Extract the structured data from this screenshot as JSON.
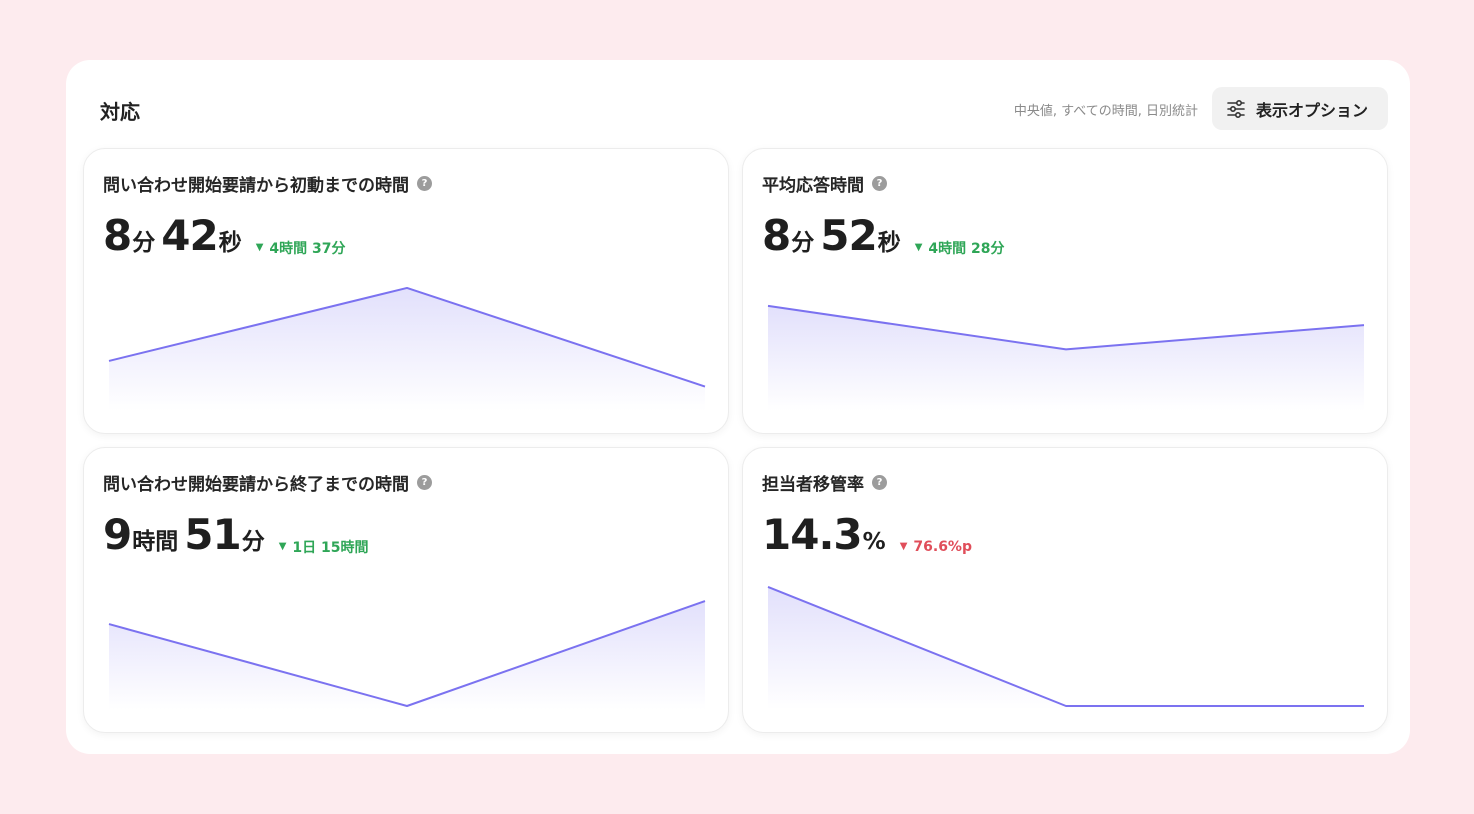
{
  "header": {
    "title": "対応",
    "subtitle": "中央値, すべての時間, 日別統計",
    "options_label": "表示オプション"
  },
  "colors": {
    "background": "#fdebee",
    "line": "#7b72f0",
    "positive": "#2fa657",
    "negative": "#e04e5a"
  },
  "cards": [
    {
      "title": "問い合わせ開始要請から初動までの時間",
      "value": [
        {
          "num": "8",
          "unit": "分"
        },
        {
          "num": "42",
          "unit": "秒"
        }
      ],
      "delta": {
        "text": "4時間 37分",
        "tone": "good",
        "icon": "triangle-down-icon"
      },
      "trend": [
        0.36,
        0.93,
        0.16
      ]
    },
    {
      "title": "平均応答時間",
      "value": [
        {
          "num": "8",
          "unit": "分"
        },
        {
          "num": "52",
          "unit": "秒"
        }
      ],
      "delta": {
        "text": "4時間 28分",
        "tone": "good",
        "icon": "triangle-down-icon"
      },
      "trend": [
        0.79,
        0.45,
        0.64
      ]
    },
    {
      "title": "問い合わせ開始要請から終了までの時間",
      "value": [
        {
          "num": "9",
          "unit": "時間"
        },
        {
          "num": "51",
          "unit": "分"
        }
      ],
      "delta": {
        "text": "1日 15時間",
        "tone": "good",
        "icon": "triangle-down-icon"
      },
      "trend": [
        0.64,
        0.0,
        0.82
      ]
    },
    {
      "title": "担当者移管率",
      "value": [
        {
          "num": "14.3",
          "unit": "%"
        }
      ],
      "delta": {
        "text": "76.6%p",
        "tone": "bad",
        "icon": "triangle-down-icon"
      },
      "trend": [
        0.93,
        0.0,
        0.0
      ]
    }
  ]
}
